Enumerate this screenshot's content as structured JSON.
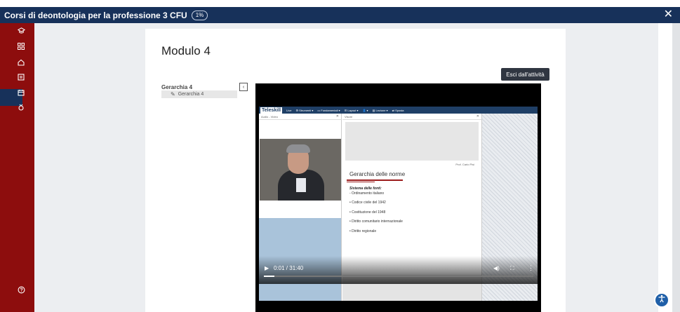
{
  "header": {
    "course_title": "Corsi di deontologia per la professione 3 CFU",
    "progress_badge": "1%",
    "close_label": "✕"
  },
  "sidebar": {
    "icons": [
      "graduation-cap-icon",
      "grid-icon",
      "home-icon",
      "book-icon",
      "calendar-icon",
      "badge-icon",
      "help-icon"
    ],
    "active_index": 3
  },
  "main": {
    "module_title": "Modulo 4",
    "exit_label": "Esci dall'attività",
    "toc": {
      "section_title": "Gerarchia 4",
      "collapse_label": "‹",
      "item_label": "Gerarchia 4"
    }
  },
  "video": {
    "app": {
      "logo": "Teleskill",
      "nav_items": [
        "Live",
        "⚙ Strumenti ▾",
        "▭ Fondamentali ▾",
        "☰ Layout ▾",
        "👤 ▾",
        "▤ Lezione ▾",
        "⇄ Sposta"
      ]
    },
    "left_panel_header": "Audio - Video",
    "slide_panel_header": "Visore",
    "slide": {
      "author": "Prof. Carlo Pisi",
      "title": "Gerarchia delle norme",
      "subtitle": "Sistema delle fonti:",
      "items": [
        "- Ordinamento italiano",
        "• Codice civile del 1942",
        "• Costituzione del 1948",
        "• Diritto comunitario internazionale",
        "• Diritto regionale"
      ]
    },
    "controls": {
      "time": "0:01 / 31:40",
      "progress_fraction": 0.04
    }
  },
  "colors": {
    "topbar": "#17315a",
    "sidebar": "#8d0d0d",
    "exit_button": "#303641"
  }
}
